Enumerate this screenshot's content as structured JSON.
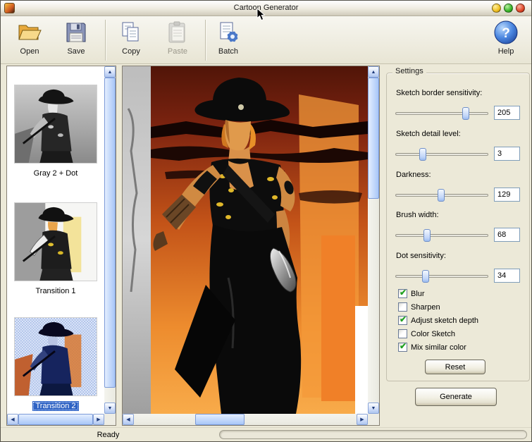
{
  "window": {
    "title": "Cartoon Generator"
  },
  "toolbar": {
    "buttons": [
      {
        "label": "Open",
        "icon": "open-folder-icon",
        "enabled": true
      },
      {
        "label": "Save",
        "icon": "save-floppy-icon",
        "enabled": true
      },
      {
        "label": "Copy",
        "icon": "copy-pages-icon",
        "enabled": true
      },
      {
        "label": "Paste",
        "icon": "paste-clipboard-icon",
        "enabled": false
      },
      {
        "label": "Batch",
        "icon": "batch-gear-icon",
        "enabled": true
      },
      {
        "label": "Help",
        "icon": "help-question-icon",
        "enabled": true
      }
    ]
  },
  "thumbnails": [
    {
      "label": "Gray 2 + Dot",
      "selected": false
    },
    {
      "label": "Transition 1",
      "selected": false
    },
    {
      "label": "Transition 2",
      "selected": true
    }
  ],
  "settings": {
    "title": "Settings",
    "sliders": [
      {
        "label": "Sketch border sensitivity:",
        "value": "205",
        "position": 0.78
      },
      {
        "label": "Sketch detail level:",
        "value": "3",
        "position": 0.28
      },
      {
        "label": "Darkness:",
        "value": "129",
        "position": 0.49
      },
      {
        "label": "Brush width:",
        "value": "68",
        "position": 0.33
      },
      {
        "label": "Dot sensitivity:",
        "value": "34",
        "position": 0.31
      }
    ],
    "checkboxes": [
      {
        "label": "Blur",
        "checked": true
      },
      {
        "label": "Sharpen",
        "checked": false
      },
      {
        "label": "Adjust sketch depth",
        "checked": true
      },
      {
        "label": "Color Sketch",
        "checked": false
      },
      {
        "label": "Mix similar color",
        "checked": true
      }
    ],
    "reset_label": "Reset",
    "generate_label": "Generate"
  },
  "statusbar": {
    "text": "Ready"
  },
  "colors": {
    "window_bg": "#ece9d8",
    "selection": "#2f63c4",
    "scrollbar_thumb": "#a8c6f8",
    "check_green": "#21a121"
  }
}
